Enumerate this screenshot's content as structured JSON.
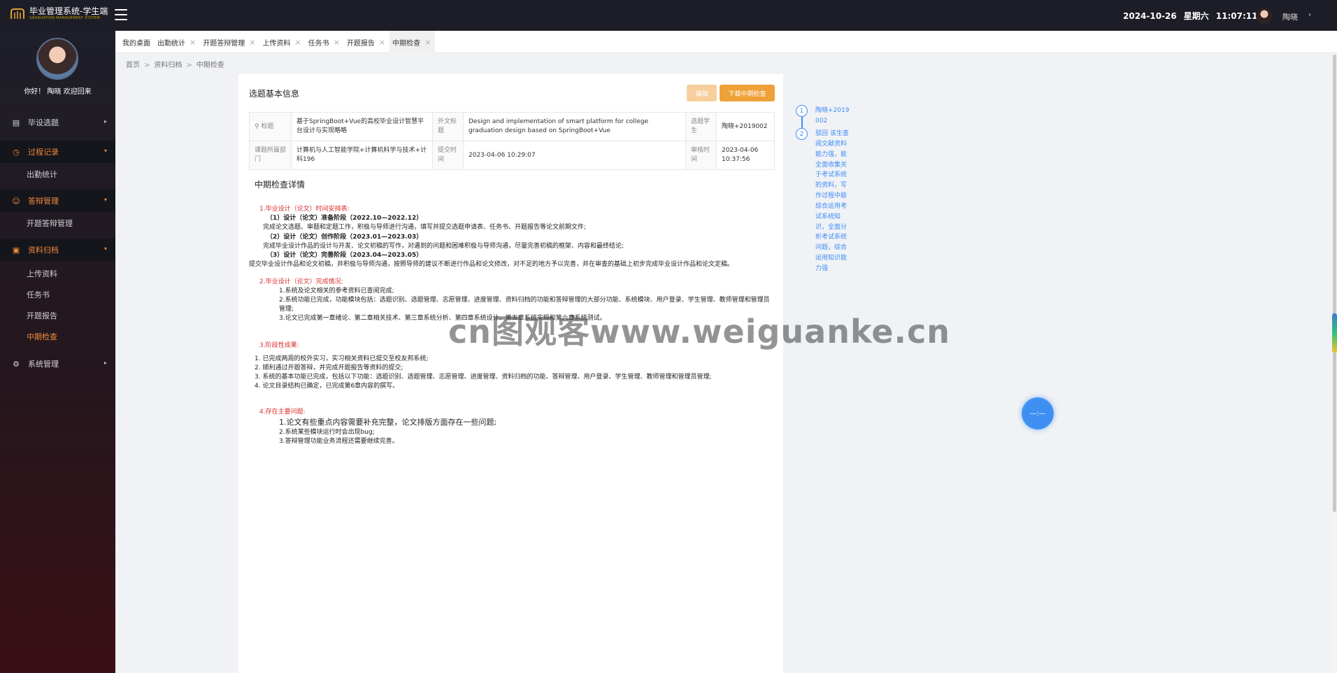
{
  "app": {
    "title": "毕业管理系统-学生端",
    "subtitle": "GRADUATION MANAGEMENT SYSTEM",
    "date": "2024-10-26",
    "weekday": "星期六",
    "time": "11:07:11",
    "username": "陶晓",
    "user_caret": "›"
  },
  "sidebar": {
    "greeting": "你好！ 陶晓 欢迎回来",
    "groups": [
      {
        "label": "毕设选题",
        "icon": "document-icon",
        "arrow": "▸"
      },
      {
        "label": "过程记录",
        "icon": "clock-icon",
        "arrow": "▾"
      },
      {
        "label": "答辩管理",
        "icon": "smile-icon",
        "arrow": "▾"
      },
      {
        "label": "资料归档",
        "icon": "file-icon",
        "arrow": "▾"
      },
      {
        "label": "系统管理",
        "icon": "gear-icon",
        "arrow": "▸"
      }
    ],
    "sub_process": [
      "出勤统计"
    ],
    "sub_defense": [
      "开题答辩管理"
    ],
    "sub_archive": [
      "上传资料",
      "任务书",
      "开题报告",
      "中期检查"
    ]
  },
  "tabs": [
    {
      "label": "我的桌面",
      "close": ""
    },
    {
      "label": "出勤统计",
      "close": "×"
    },
    {
      "label": "开题答辩管理",
      "close": "×"
    },
    {
      "label": "上传资料",
      "close": "×"
    },
    {
      "label": "任务书",
      "close": "×"
    },
    {
      "label": "开题报告",
      "close": "×"
    },
    {
      "label": "中期检查",
      "close": "×"
    }
  ],
  "breadcrumb": [
    "首页",
    "资料归档",
    "中期检查"
  ],
  "breadcrumb_sep": ">",
  "card": {
    "title": "选题基本信息",
    "edit_label": "编辑",
    "download_label": "下载中期检查"
  },
  "info": {
    "title_label": "标题",
    "title_value": "基于SpringBoot+Vue的高校毕业设计智慧平台设计与实现略略",
    "foreign_label": "外文标题",
    "foreign_value": "Design and implementation of smart platform for college graduation design based on SpringBoot+Vue",
    "student_label": "选题学生",
    "student_value": "陶晓+2019002",
    "dept_label": "课题所属部门",
    "dept_value": "计算机与人工智能学院+计算机科学与技术+计科196",
    "submit_label": "提交时间",
    "submit_value": "2023-04-06 10:29:07",
    "review_label": "审核时间",
    "review_value": "2023-04-06 10:37:56"
  },
  "detail": {
    "title": "中期检查详情",
    "sec1_head": "1.毕业设计（论文）时间安排表:",
    "s1_p1_h": "（1）设计（论文）准备阶段（2022.10—2022.12）",
    "s1_p1_t": "完成论文选题、审题和定题工作，积极与导师进行沟通，填写并提交选题申请表、任务书、开题报告等论文前期文件;",
    "s1_p2_h": "（2）设计（论文）创作阶段（2023.01—2023.03）",
    "s1_p2_t": "完成毕业设计作品的设计与开发、论文初稿的写作，对遇到的问题和困难积极与导师沟通，尽量完善初稿的框架、内容和最终结论;",
    "s1_p3_h": "（3）设计（论文）完善阶段（2023.04—2023.05）",
    "s1_p3_t": "提交毕业设计作品和论文初稿，并积极与导师沟通，按照导师的建议不断进行作品和论文修改，对不足的地方予以完善，并在审查的基础上初步完成毕业设计作品和论文定稿。",
    "sec2_head": "2.毕业设计（论文）完成情况:",
    "s2_1": "1.系统及论文相关的参考资料已查阅完成;",
    "s2_2": "2.系统功能已完成，功能模块包括：选题识别、选题管理、志愿管理、进度管理、资料归档的功能和答辩管理的大部分功能、系统模块、用户登录、学生管理、教师管理和管理员管理;",
    "s2_3": "3.论文已完成第一章绪论、第二章相关技术、第三章系统分析、第四章系统设计、第五章系统实现和第六章系统测试。",
    "sec3_head": "3.阶段性成果:",
    "s3_1": "1. 已完成两周的校外实习，实习相关资料已提交至校友邦系统;",
    "s3_2": "2. 顺利通过开题答辩，并完成开题报告等资料的提交;",
    "s3_3": "3. 系统的基本功能已完成，包括以下功能：选题识别、选题管理、志愿管理、进度管理、资料归档的功能、答辩管理、用户登录、学生管理、教师管理和管理员管理;",
    "s3_4": "4. 论文目录结构已确定，已完成第6章内容的撰写。",
    "sec4_head": "4.存在主要问题:",
    "s4_1": "1.论文有些重点内容需要补充完整，论文排版方面存在一些问题;",
    "s4_2": "2.系统某些模块运行时会出现bug;",
    "s4_3": "3.答辩管理功能业务流程还需要继续完善。"
  },
  "timeline": [
    {
      "num": "1",
      "text": "陶晓+2019002"
    },
    {
      "num": "2",
      "text": "驳回 该生查阅文献资料能力强，能全面收集关于考试系统的资料，写作过程中能综合运用考试系统知识，全面分析考试系统问题，综合运用知识能力强"
    }
  ],
  "fab": {
    "label": "—:—"
  },
  "watermark": "cn图观客www.weiguanke.cn",
  "colors": {
    "accent": "#f08a3c",
    "link": "#3d8ef7",
    "danger": "#d9302c",
    "button": "#eea138"
  }
}
